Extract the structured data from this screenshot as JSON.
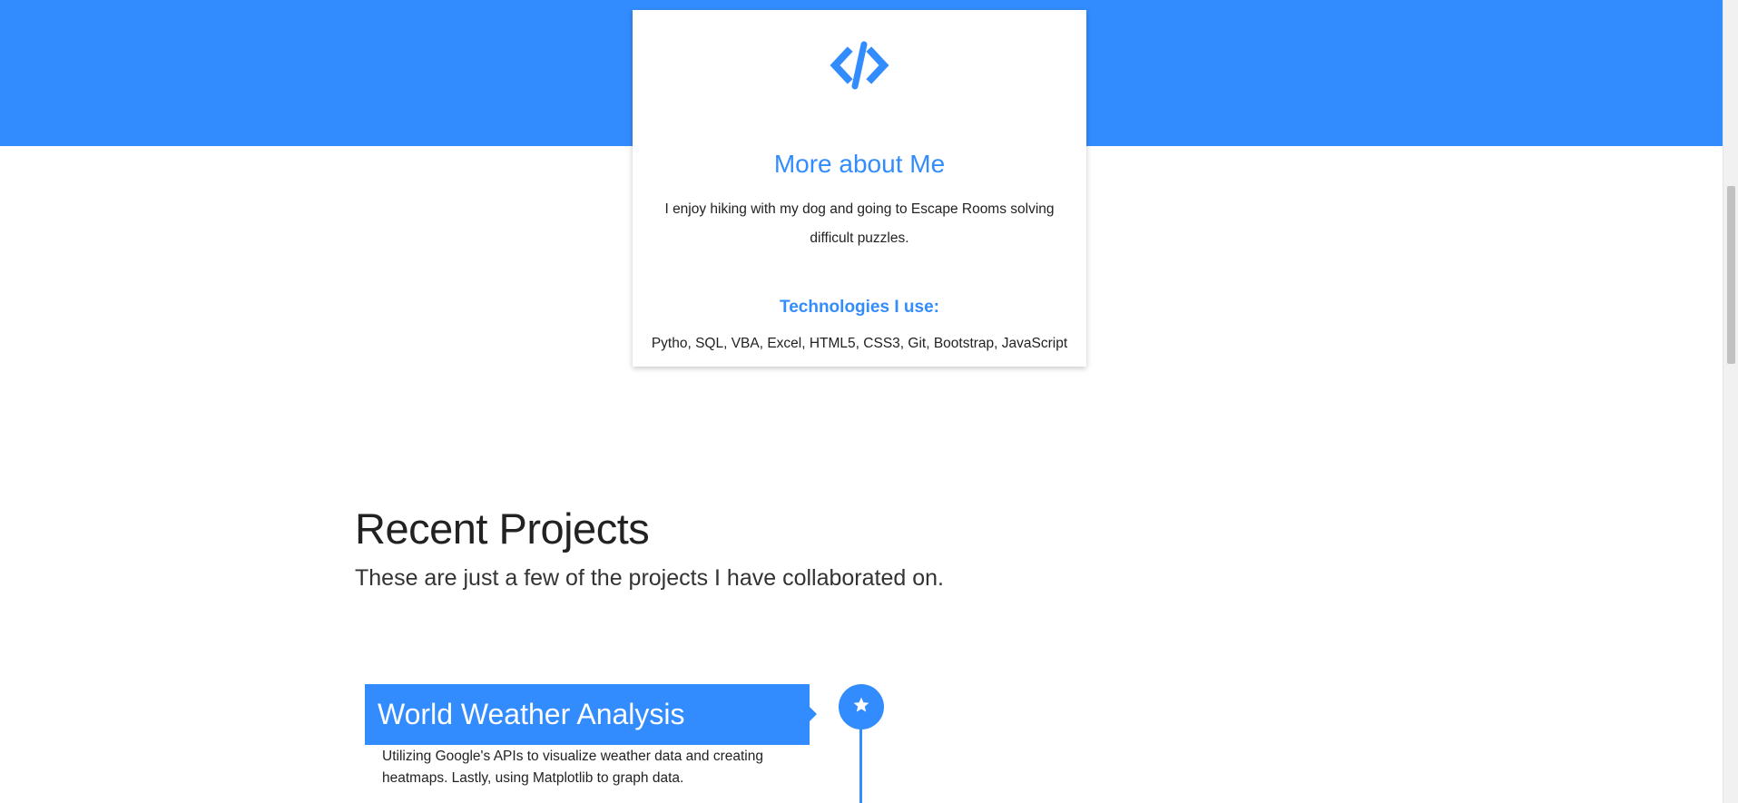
{
  "colors": {
    "accent": "#338cfe",
    "band": "#338cfe"
  },
  "about_card": {
    "icon": "code-icon",
    "title": "More about Me",
    "text": "I enjoy hiking with my dog and going to Escape Rooms solving difficult puzzles.",
    "subtitle": "Technologies I use:",
    "technologies": "Pytho, SQL, VBA, Excel, HTML5, CSS3, Git, Bootstrap, JavaScript"
  },
  "projects_section": {
    "title": "Recent Projects",
    "subtitle": "These are just a few of the projects I have collaborated on.",
    "items": [
      {
        "title": "World Weather Analysis",
        "description": "Utilizing Google's APIs to visualize weather data and creating heatmaps. Lastly, using Matplotlib to graph data.",
        "badge_icon": "star-icon"
      }
    ]
  }
}
